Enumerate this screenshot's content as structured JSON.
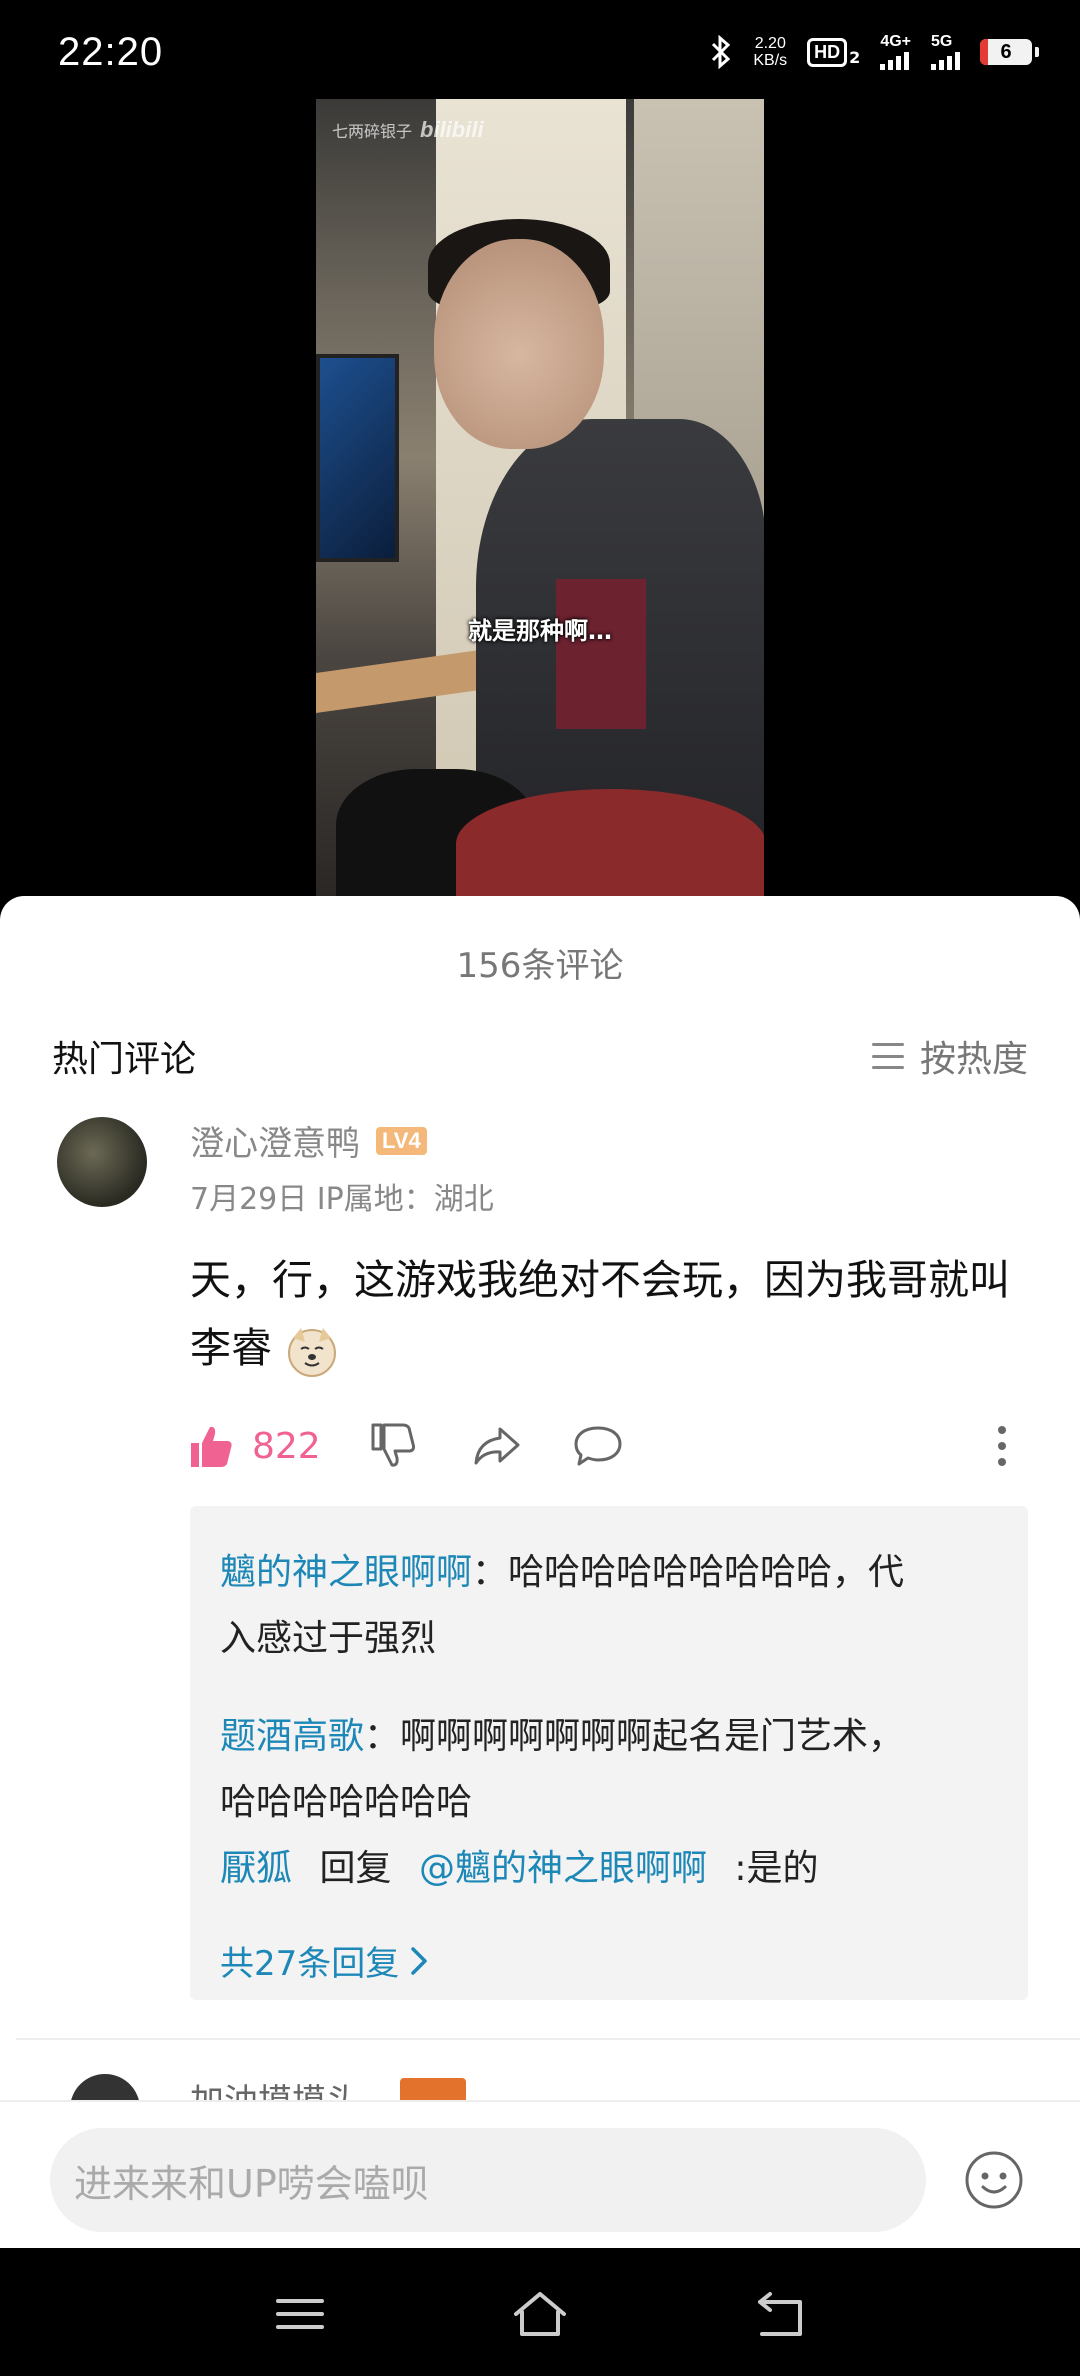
{
  "status_bar": {
    "time": "22:20",
    "net_speed_value": "2.20",
    "net_speed_unit": "KB/s",
    "hd_badge": "HD",
    "hd_sub": "2",
    "sim1_label": "4G+",
    "sim2_label": "5G",
    "battery": "6"
  },
  "video": {
    "watermark_text": "七两碎银子",
    "watermark_brand": "bilibili",
    "subtitle": "就是那种啊…"
  },
  "comments": {
    "count_label": "156条评论",
    "section_title": "热门评论",
    "sort_label": "按热度",
    "top_comment": {
      "username": "澄心澄意鸭",
      "level": "LV4",
      "meta": "7月29日  IP属地：湖北",
      "text": "天，行，这游戏我绝对不会玩，因为我哥就叫李睿",
      "likes": "822"
    },
    "replies": [
      {
        "name": "魑的神之眼啊啊",
        "text": "：哈哈哈哈哈哈哈哈哈，代入感过于强烈"
      },
      {
        "name": "题酒高歌",
        "text": "：啊啊啊啊啊啊啊起名是门艺术，哈哈哈哈哈哈哈"
      }
    ],
    "reply3": {
      "name": "厭狐",
      "reply_word": "回复",
      "mention": "@魑的神之眼啊啊",
      "text": ":是的"
    },
    "more_replies": "共27条回复",
    "next_comment_name": "加油摸摸头"
  },
  "input": {
    "placeholder": "进来来和UP唠会嗑呗"
  },
  "colors": {
    "accent_pink": "#f06292",
    "link_blue": "#1d88b7",
    "level_badge": "#f4b97a"
  },
  "icons": [
    "bluetooth-icon",
    "signal-icon",
    "battery-icon",
    "sort-icon",
    "like-icon",
    "dislike-icon",
    "share-icon",
    "reply-icon",
    "more-icon",
    "chevron-right-icon",
    "emoji-icon",
    "menu-nav-icon",
    "home-nav-icon",
    "back-nav-icon"
  ]
}
